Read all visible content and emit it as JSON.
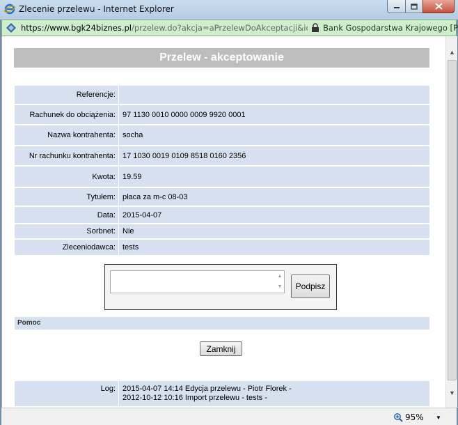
{
  "window": {
    "title": "Zlecenie przelewu - Internet Explorer"
  },
  "address": {
    "url_host": "https://www.bgk24biznes.pl",
    "url_rest": "/przelew.do?akcja=aPrzelewDoAkceptacji&idRacl",
    "site_identity": "Bank Gospodarstwa Krajowego [PL]"
  },
  "page": {
    "heading": "Przelew - akceptowanie",
    "fields": [
      {
        "label": "Referencje:",
        "value": ""
      },
      {
        "label": "Rachunek do obciążenia:",
        "value": "97 1130 0010 0000 0009 9920 0001"
      },
      {
        "label": "Nazwa kontrahenta:",
        "value": "socha"
      },
      {
        "label": "Nr rachunku kontrahenta:",
        "value": "17 1030 0019 0109 8518 0160 2356"
      },
      {
        "label": "Kwota:",
        "value": "19.59"
      },
      {
        "label": "Tytułem:",
        "value": "płaca za m-c 08-03"
      },
      {
        "label": "Data:",
        "value": "2015-04-07"
      },
      {
        "label": "Sorbnet:",
        "value": "Nie"
      },
      {
        "label": "Zleceniodawca:",
        "value": "tests"
      }
    ],
    "sign": {
      "text_value": "",
      "button_label": "Podpisz"
    },
    "help_label": "Pomoc",
    "close_button_label": "Zamknij",
    "log": {
      "label": "Log:",
      "lines": [
        "2015-04-07 14:14 Edycja przelewu - Piotr Florek -",
        "2012-10-12 10:16 Import przelewu -  tests -"
      ]
    }
  },
  "status": {
    "zoom": "95%"
  },
  "colors": {
    "row_bg": "#d6e0ef",
    "header_bg": "#bdbdbd",
    "address_bg": "#cfeecb"
  }
}
